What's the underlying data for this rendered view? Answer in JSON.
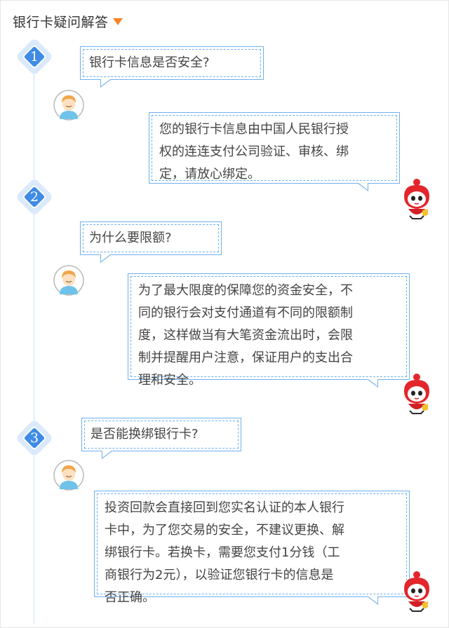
{
  "header": {
    "title": "银行卡疑问解答"
  },
  "faqs": [
    {
      "step": "1",
      "question": "银行卡信息是否安全?",
      "answer_lines": [
        "您的银行卡信息由中国人民银行授",
        "权的连连支付公司验证、审核、绑",
        "定，请放心绑定。"
      ]
    },
    {
      "step": "2",
      "question": "为什么要限额?",
      "answer_lines": [
        "为了最大限度的保障您的资金安全，不",
        "同的银行会对支付通道有不同的限额制",
        "度，这样做当有大笔资金流出时，会限",
        "制并提醒用户注意，保证用户的支出合",
        "理和安全。"
      ]
    },
    {
      "step": "3",
      "question": "是否能换绑银行卡?",
      "answer_lines": [
        "投资回款会直接回到您实名认证的本人银行",
        "卡中，为了您交易的安全，不建议更换、解",
        "绑银行卡。若换卡，需要您支付1分钱（工",
        "商银行为2元），以验证您银行卡的信息是",
        "否正确。"
      ]
    }
  ],
  "colors": {
    "accent": "#3f8be6",
    "bubble_border": "#6fb0ee",
    "arrow": "#f5832a",
    "mascot": "#e3262b"
  },
  "icons": {
    "user": "user-avatar-icon",
    "mascot": "mascot-avatar-icon",
    "dropdown": "triangle-down-icon"
  }
}
